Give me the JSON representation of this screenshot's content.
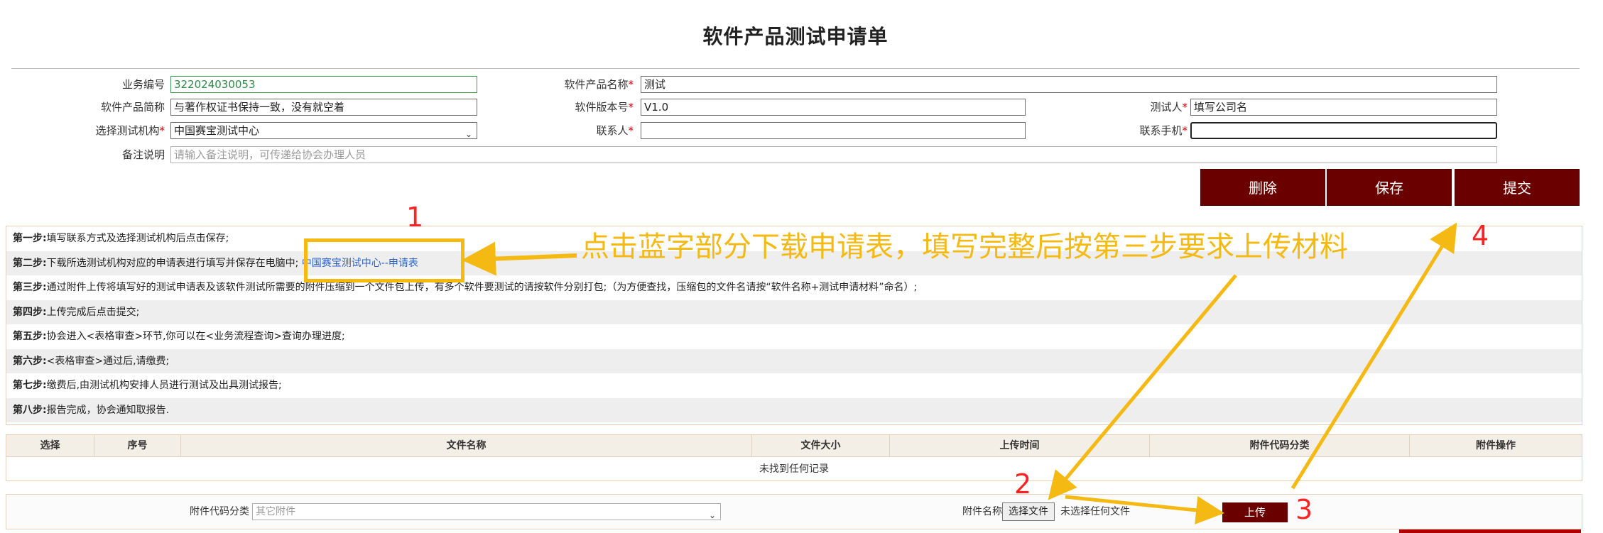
{
  "page_title": "软件产品测试申请单",
  "form": {
    "business_no_label": "业务编号",
    "business_no_value": "322024030053",
    "product_name_label": "软件产品名称",
    "product_name_value": "测试",
    "short_name_label": "软件产品简称",
    "short_name_value": "与著作权证书保持一致，没有就空着",
    "version_label": "软件版本号",
    "version_value": "V1.0",
    "tester_label": "测试人",
    "tester_value": "填写公司名",
    "institution_label": "选择测试机构",
    "institution_value": "中国赛宝测试中心",
    "contact_label": "联系人",
    "contact_value": "",
    "phone_label": "联系手机",
    "phone_value": "",
    "remark_label": "备注说明",
    "remark_placeholder": "请输入备注说明，可传递给协会办理人员",
    "required_mark": "*"
  },
  "actions": {
    "delete": "删除",
    "save": "保存",
    "submit": "提交"
  },
  "steps": [
    {
      "head": "第一步:",
      "text": "填写联系方式及选择测试机构后点击保存;"
    },
    {
      "head": "第二步:",
      "text": "下载所选测试机构对应的申请表进行填写并保存在电脑中; ",
      "link": "中国赛宝测试中心--申请表"
    },
    {
      "head": "第三步:",
      "text": "通过附件上传将填写好的测试申请表及该软件测试所需要的附件压缩到一个文件包上传，有多个软件要测试的请按软件分别打包;（为方便查找，压缩包的文件名请按“软件名称+测试申请材料”命名）;"
    },
    {
      "head": "第四步:",
      "text": "上传完成后点击提交;"
    },
    {
      "head": "第五步:",
      "text": "协会进入<表格审查>环节,你可以在<业务流程查询>查询办理进度;"
    },
    {
      "head": "第六步:",
      "text": "<表格审查>通过后,请缴费;"
    },
    {
      "head": "第七步:",
      "text": "缴费后,由测试机构安排人员进行测试及出具测试报告;"
    },
    {
      "head": "第八步:",
      "text": "报告完成，协会通知取报告."
    }
  ],
  "table": {
    "headers": [
      "选择",
      "序号",
      "文件名称",
      "文件大小",
      "上传时间",
      "附件代码分类",
      "附件操作"
    ],
    "empty_text": "未找到任何记录"
  },
  "upload": {
    "category_label": "附件代码分类",
    "category_value": "其它附件",
    "file_label": "附件名称",
    "choose_file": "选择文件",
    "no_file": "未选择任何文件",
    "upload_button": "上传"
  },
  "annotations": {
    "instruction": "点击蓝字部分下载申请表，填写完整后按第三步要求上传材料",
    "n1": "1",
    "n2": "2",
    "n3": "3",
    "n4": "4"
  },
  "colors": {
    "accent": "#6b0000",
    "annotation": "#f5b914",
    "annotation_number": "#ff2222",
    "link": "#2a62c9"
  }
}
